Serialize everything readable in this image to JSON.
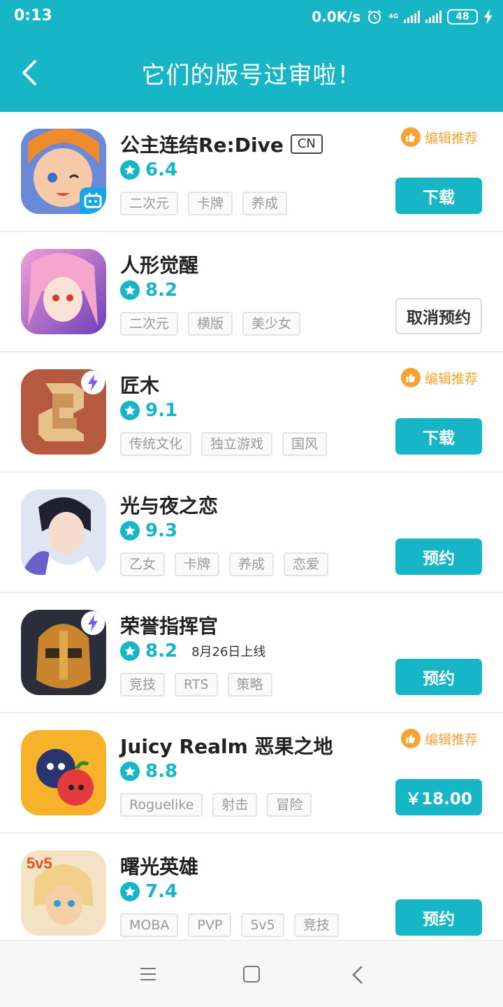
{
  "status_bar": {
    "time": "0:13",
    "speed": "0.0K/s",
    "network": "4G",
    "battery": "48"
  },
  "header": {
    "title": "它们的版号过审啦！"
  },
  "colors": {
    "accent": "#16b6c6",
    "recommend": "#f7a334"
  },
  "apps": [
    {
      "name": "公主连结Re:Dive",
      "badge": "CN",
      "rating": "6.4",
      "tags": [
        "二次元",
        "卡牌",
        "养成"
      ],
      "recommend": "编辑推荐",
      "action": "下载",
      "icon": "princess-connect-icon",
      "release": ""
    },
    {
      "name": "人形觉醒",
      "rating": "8.2",
      "tags": [
        "二次元",
        "横版",
        "美少女"
      ],
      "action": "取消预约",
      "icon": "anime-girl-icon",
      "release": ""
    },
    {
      "name": "匠木",
      "rating": "9.1",
      "tags": [
        "传统文化",
        "独立游戏",
        "国风"
      ],
      "recommend": "编辑推荐",
      "action": "下载",
      "icon": "wooden-puzzle-icon",
      "release": ""
    },
    {
      "name": "光与夜之恋",
      "rating": "9.3",
      "tags": [
        "乙女",
        "卡牌",
        "养成",
        "恋爱"
      ],
      "action": "预约",
      "icon": "anime-boy-icon",
      "release": ""
    },
    {
      "name": "荣誉指挥官",
      "rating": "8.2",
      "release": "8月26日上线",
      "tags": [
        "竞技",
        "RTS",
        "策略"
      ],
      "action": "预约",
      "icon": "knight-helmet-icon"
    },
    {
      "name": "Juicy Realm 恶果之地",
      "rating": "8.8",
      "tags": [
        "Roguelike",
        "射击",
        "冒险"
      ],
      "recommend": "编辑推荐",
      "action": "￥18.00",
      "icon": "fruit-monster-icon",
      "release": ""
    },
    {
      "name": "曙光英雄",
      "rating": "7.4",
      "tags": [
        "MOBA",
        "PVP",
        "5v5",
        "竞技"
      ],
      "action": "预约",
      "icon": "hero-5v5-icon",
      "release": ""
    }
  ]
}
